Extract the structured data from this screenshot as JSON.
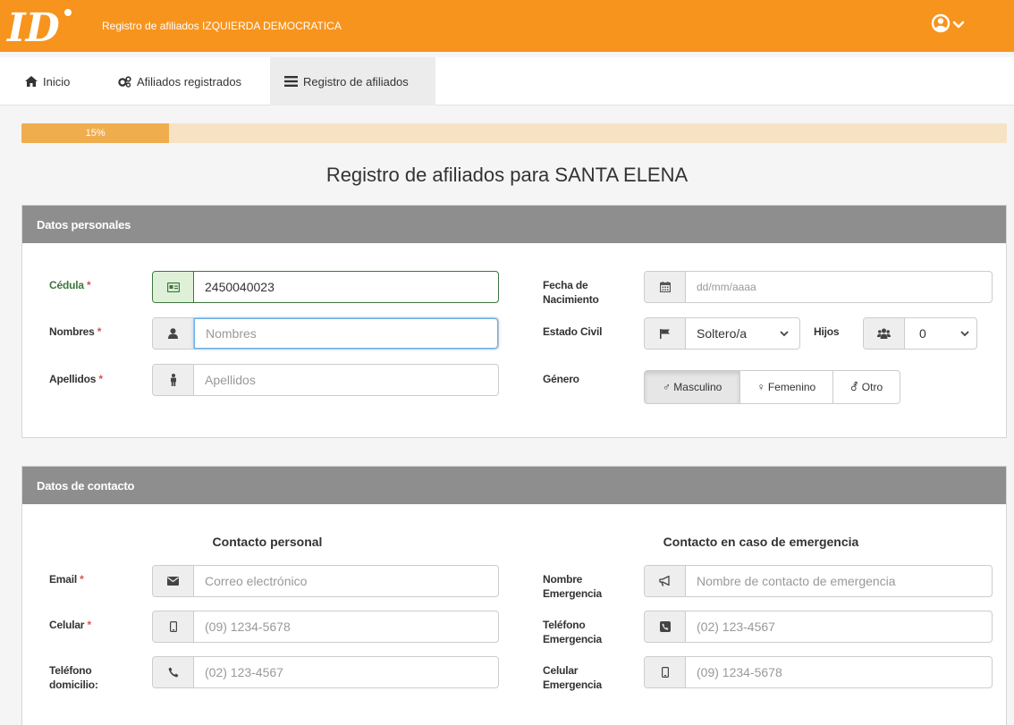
{
  "app": {
    "title": "Registro de afiliados IZQUIERDA DEMOCRATICA",
    "logo_text": "ID",
    "brand_color": "#f7941d"
  },
  "nav": {
    "items": [
      {
        "label": "Inicio",
        "icon": "home-icon"
      },
      {
        "label": "Afiliados registrados",
        "icon": "cogs-icon"
      },
      {
        "label": "Registro de afiliados",
        "icon": "list-icon",
        "active": true
      }
    ]
  },
  "progress": {
    "value": 15,
    "label": "15%"
  },
  "page": {
    "title": "Registro de afiliados para SANTA ELENA"
  },
  "personal": {
    "heading": "Datos personales",
    "cedula": {
      "label": "Cédula",
      "value": "2450040023",
      "placeholder": ""
    },
    "nombres": {
      "label": "Nombres",
      "value": "",
      "placeholder": "Nombres"
    },
    "apellidos": {
      "label": "Apellidos",
      "value": "",
      "placeholder": "Apellidos"
    },
    "fecha": {
      "label": "Fecha de Nacimiento",
      "placeholder": "dd/mm/aaaa"
    },
    "estado_civil": {
      "label": "Estado Civil",
      "value": "Soltero/a"
    },
    "hijos": {
      "label": "Hijos",
      "value": "0"
    },
    "genero": {
      "label": "Género",
      "options": [
        "♂ Masculino",
        "♀ Femenino",
        "⚦ Otro"
      ],
      "selected": 0
    },
    "required_mark": "*"
  },
  "contact": {
    "heading": "Datos de contacto",
    "personal_title": "Contacto personal",
    "emergency_title": "Contacto en caso de emergencia",
    "email": {
      "label": "Email",
      "placeholder": "Correo electrónico"
    },
    "celular": {
      "label": "Celular",
      "placeholder": "(09) 1234-5678"
    },
    "telefono": {
      "label": "Teléfono domicilio:",
      "placeholder": "(02) 123-4567"
    },
    "nombre_emergencia": {
      "label": "Nombre Emergencia",
      "placeholder": "Nombre de contacto de emergencia"
    },
    "telefono_emergencia": {
      "label": "Teléfono Emergencia",
      "placeholder": "(02) 123-4567"
    },
    "celular_emergencia": {
      "label": "Celular Emergencia",
      "placeholder": "(09) 1234-5678"
    }
  }
}
